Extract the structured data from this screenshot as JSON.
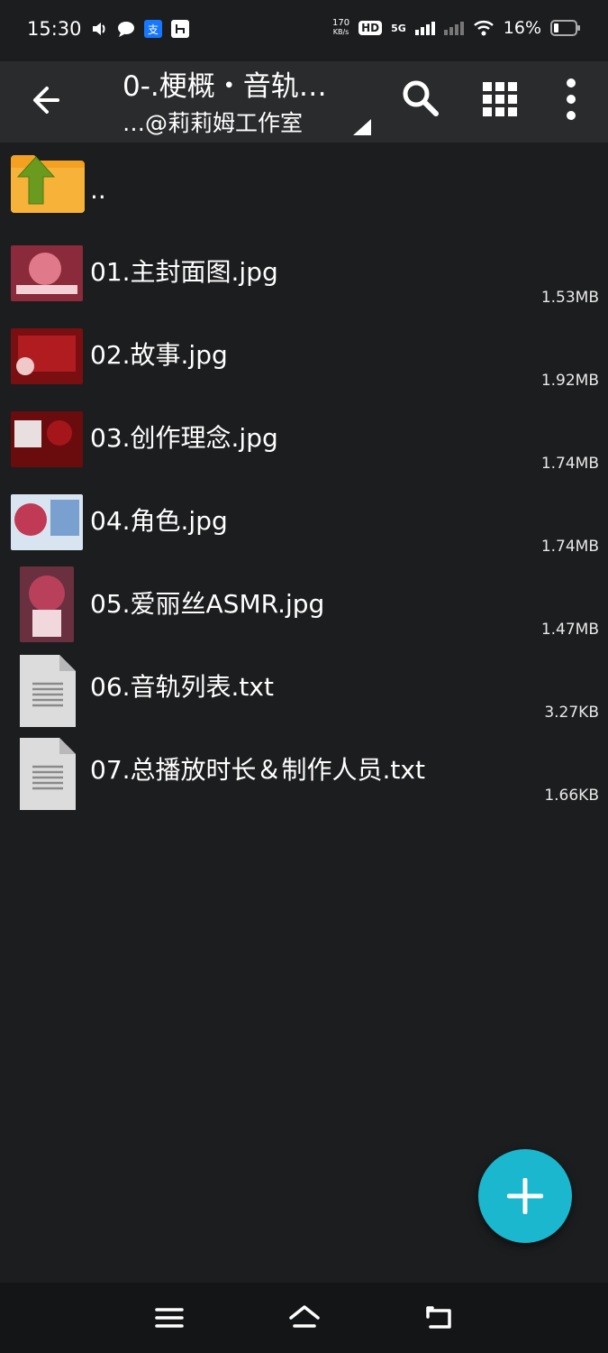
{
  "status_bar": {
    "time": "15:30",
    "net_speed_value": "170",
    "net_speed_unit": "KB/s",
    "hd_label": "HD",
    "network_label": "5G",
    "battery": "16%",
    "left_icons": [
      "volume-icon",
      "chat-bubble-icon",
      "alipay-icon",
      "app-icon"
    ]
  },
  "app_bar": {
    "title": "0-.梗概・音轨…",
    "subtitle": "…@莉莉姆工作室",
    "actions": [
      "search-icon",
      "grid-view-icon",
      "more-vert-icon"
    ]
  },
  "parent_dir": {
    "label": ".."
  },
  "files": [
    {
      "name": "01.主封面图.jpg",
      "size": "1.53MB",
      "kind": "image",
      "thumb_colors": [
        "#8a2a3a",
        "#e07a8a",
        "#f2d0d6"
      ]
    },
    {
      "name": "02.故事.jpg",
      "size": "1.92MB",
      "kind": "image",
      "thumb_colors": [
        "#7a0f12",
        "#b01c20",
        "#f0c8c8"
      ]
    },
    {
      "name": "03.创作理念.jpg",
      "size": "1.74MB",
      "kind": "image",
      "thumb_colors": [
        "#6a0c0e",
        "#a5161a",
        "#e8e0e0"
      ]
    },
    {
      "name": "04.角色.jpg",
      "size": "1.74MB",
      "kind": "image",
      "thumb_colors": [
        "#c03a55",
        "#d8e4f0",
        "#7aa0d0"
      ]
    },
    {
      "name": "05.爱丽丝ASMR.jpg",
      "size": "1.47MB",
      "kind": "image-portrait",
      "thumb_colors": [
        "#b8405a",
        "#f0d8dc",
        "#6a3040"
      ]
    },
    {
      "name": "06.音轨列表.txt",
      "size": "3.27KB",
      "kind": "text"
    },
    {
      "name": "07.总播放时长＆制作人员.txt",
      "size": "1.66KB",
      "kind": "text"
    }
  ],
  "fab": {
    "icon": "add-icon",
    "color": "#1ab7cf"
  },
  "nav_bar": {
    "buttons": [
      "menu-icon",
      "home-icon",
      "back-nav-icon"
    ]
  }
}
